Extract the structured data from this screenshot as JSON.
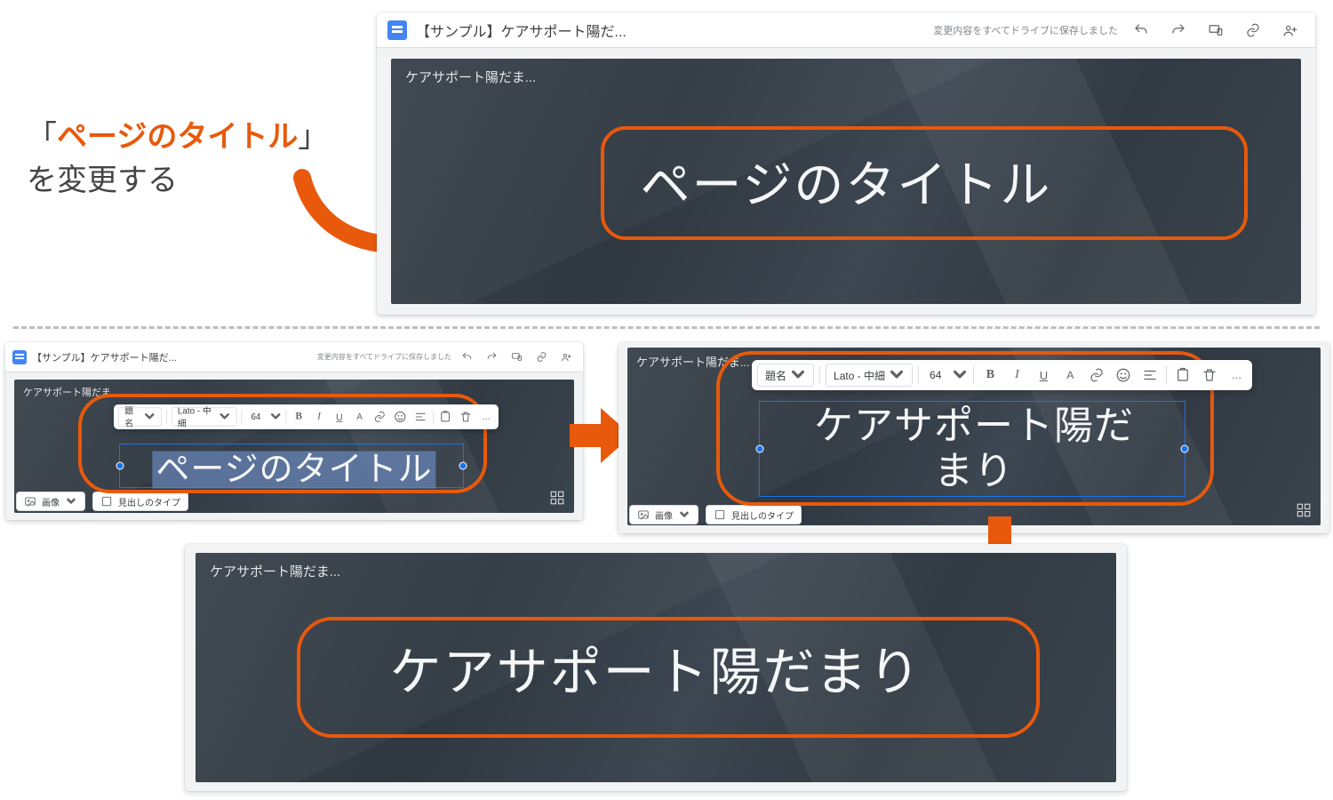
{
  "instruction": {
    "highlight_open": "「",
    "highlight_text": "ページのタイトル",
    "highlight_close": "」",
    "rest": "を変更する"
  },
  "doc_title": "【サンプル】ケアサポート陽だ...",
  "save_status": "変更内容をすべてドライブに保存しました",
  "site_name_short": "ケアサポート陽だま...",
  "site_name_short2": "ケアサポート陽だま",
  "panel1": {
    "title": "ページのタイトル"
  },
  "panel2": {
    "title": "ページのタイトル"
  },
  "panel3": {
    "title_line1": "ケアサポート陽だ",
    "title_line2": "まり"
  },
  "panel4": {
    "title": "ケアサポート陽だまり"
  },
  "toolbar": {
    "style": "題名",
    "font": "Lato - 中細",
    "size": "64",
    "bold": "B",
    "italic": "I",
    "underline": "U",
    "textA": "A",
    "more": "…"
  },
  "bottom": {
    "image": "画像",
    "heading_type": "見出しのタイプ"
  }
}
